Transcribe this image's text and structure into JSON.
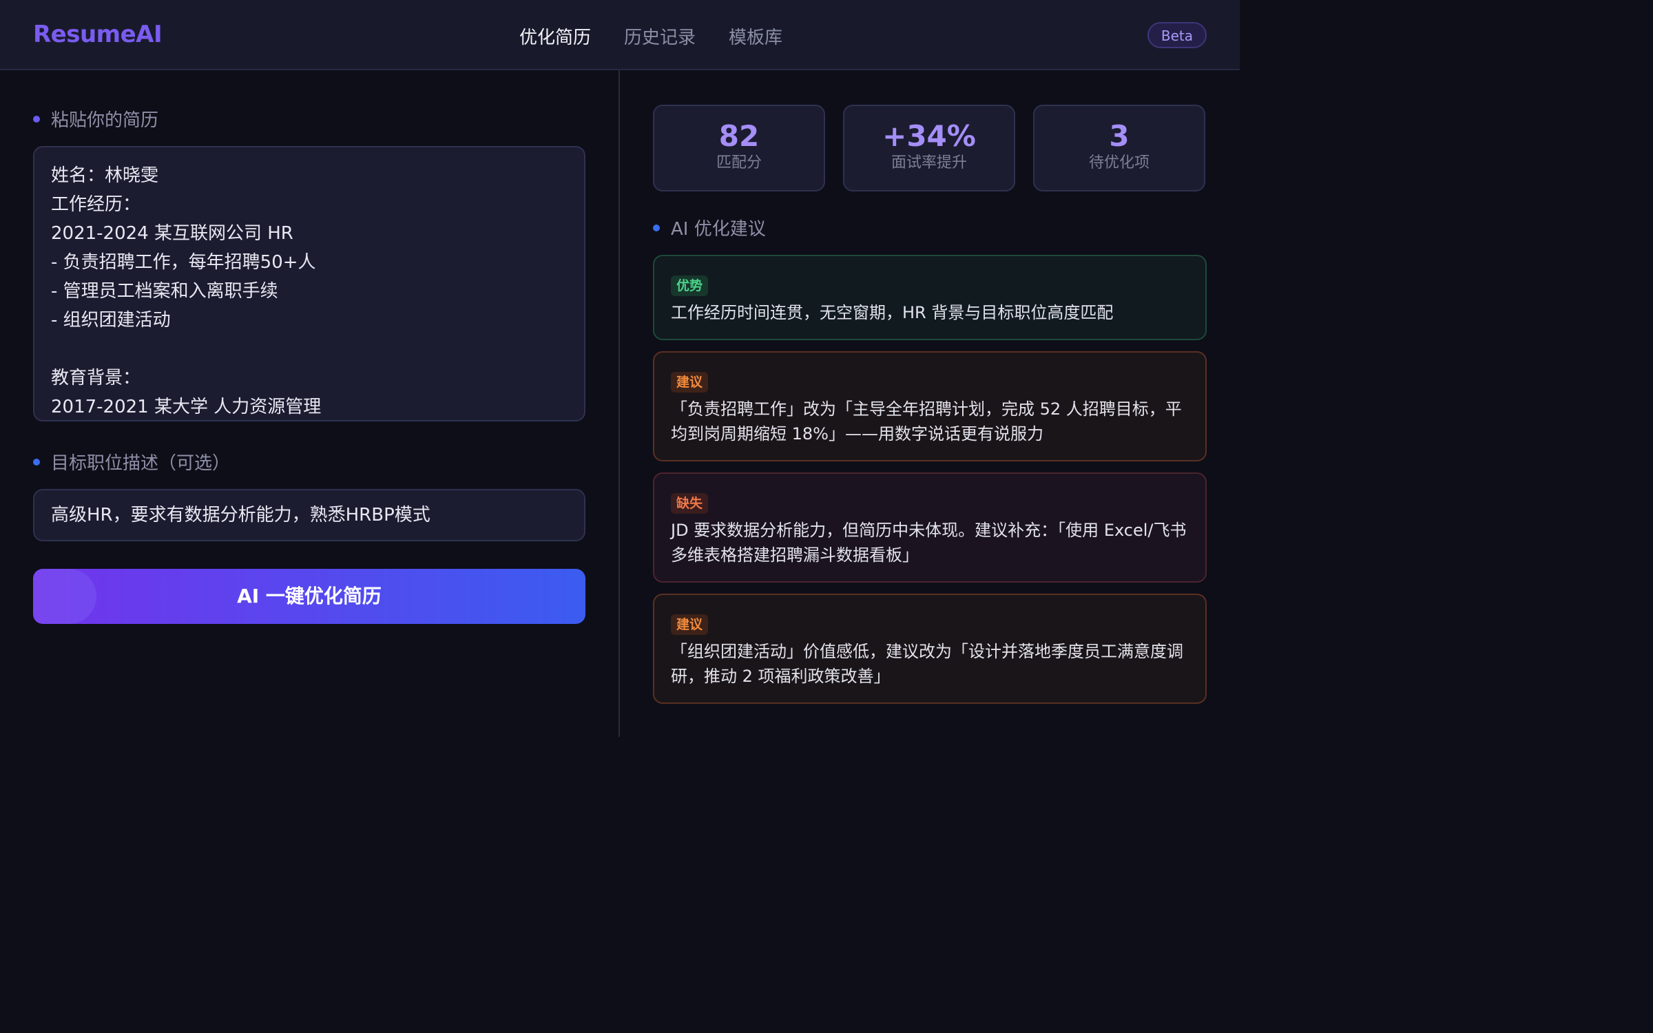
{
  "app": {
    "logo": "ResumeAI",
    "nav": [
      {
        "label": "优化简历",
        "active": true
      },
      {
        "label": "历史记录",
        "active": false
      },
      {
        "label": "模板库",
        "active": false
      }
    ],
    "badge": "Beta"
  },
  "left": {
    "resume_label": "粘贴你的简历",
    "resume_lines": [
      "姓名：林晓雯",
      "工作经历：",
      "2021-2024 某互联网公司 HR",
      "- 负责招聘工作，每年招聘50+人",
      "- 管理员工档案和入离职手续",
      "- 组织团建活动",
      "",
      "教育背景：",
      "2017-2021 某大学 人力资源管理"
    ],
    "target_label": "目标职位描述（可选）",
    "target_value": "高级HR，要求有数据分析能力，熟悉HRBP模式",
    "button_label": "AI 一键优化简历"
  },
  "right": {
    "stats": [
      {
        "value": "82",
        "label": "匹配分"
      },
      {
        "value": "+34%",
        "label": "面试率提升"
      },
      {
        "value": "3",
        "label": "待优化项"
      }
    ],
    "suggestions_label": "AI 优化建议",
    "cards": [
      {
        "tag": "优势",
        "kind": "good",
        "text": "工作经历时间连贯，无空窗期，HR 背景与目标职位高度匹配"
      },
      {
        "tag": "建议",
        "kind": "suggest",
        "text": "「负责招聘工作」改为「主导全年招聘计划，完成 52 人招聘目标，平均到岗周期缩短 18%」——用数字说话更有说服力"
      },
      {
        "tag": "缺失",
        "kind": "missing",
        "text": "JD 要求数据分析能力，但简历中未体现。建议补充：「使用 Excel/飞书多维表格搭建招聘漏斗数据看板」"
      },
      {
        "tag": "建议",
        "kind": "suggest",
        "text": "「组织团建活动」价值感低，建议改为「设计并落地季度员工满意度调研，推动 2 项福利政策改善」"
      }
    ]
  },
  "colors": {
    "accent": "#7a5cf0",
    "button_start": "#7234ec",
    "button_end": "#3b5cf0",
    "good": "#4ad48a",
    "suggest": "#f08a3c",
    "missing": "#f0784a",
    "page_bg": "#0e0e18"
  }
}
